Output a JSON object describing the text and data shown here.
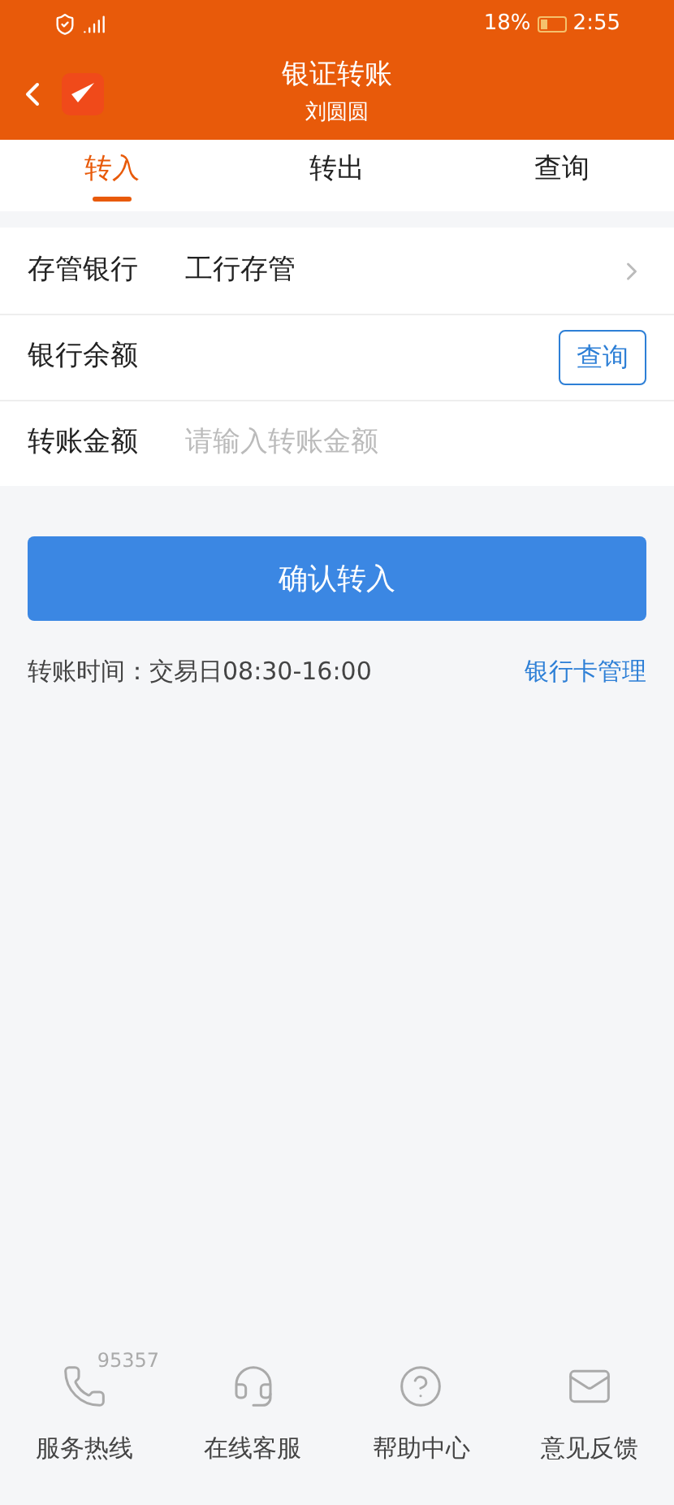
{
  "status_bar": {
    "battery": "18%",
    "time": "2:55"
  },
  "header": {
    "title": "银证转账",
    "subtitle": "刘圆圆"
  },
  "tabs": [
    {
      "label": "转入",
      "selected": true
    },
    {
      "label": "转出",
      "selected": false
    },
    {
      "label": "查询",
      "selected": false
    }
  ],
  "form": [
    {
      "kind": "select",
      "label": "存管银行",
      "value": "工行存管"
    },
    {
      "kind": "action",
      "label": "银行余额",
      "button": "查询"
    },
    {
      "kind": "input",
      "label": "转账金额",
      "placeholder": "请输入转账金额"
    }
  ],
  "confirm_button": "确认转入",
  "note": "转账时间：交易日08:30-16:00",
  "manage_link": "银行卡管理",
  "footer": [
    {
      "kind": "phone",
      "label": "服务热线",
      "badge": "95357"
    },
    {
      "kind": "headset",
      "label": "在线客服"
    },
    {
      "kind": "help",
      "label": "帮助中心"
    },
    {
      "kind": "mail",
      "label": "意见反馈"
    }
  ]
}
